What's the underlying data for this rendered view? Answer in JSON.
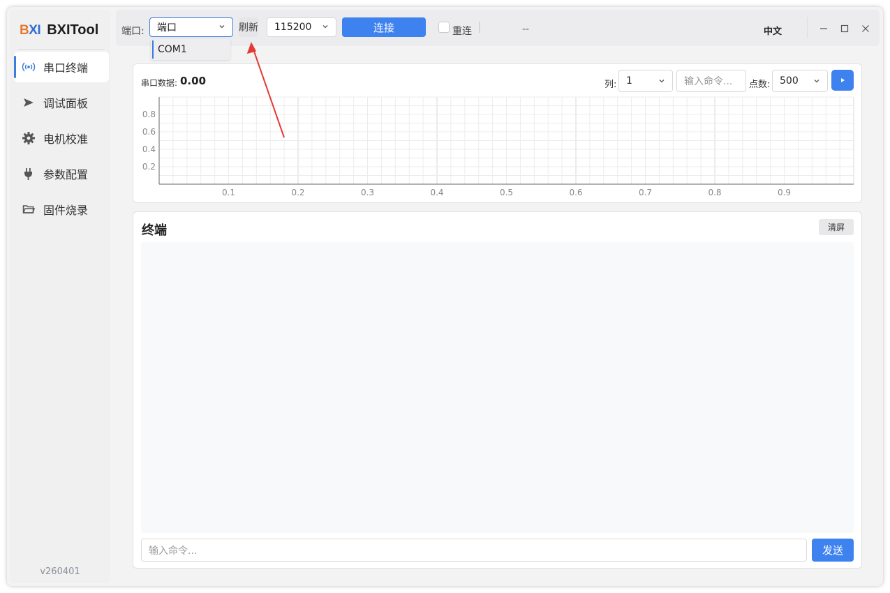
{
  "app": {
    "logo_part1": "B",
    "logo_part2": "XI",
    "name": "BXITool",
    "version": "v260401"
  },
  "sidebar": {
    "items": [
      {
        "label": "串口终端",
        "icon": "signal-icon",
        "active": true
      },
      {
        "label": "调试面板",
        "icon": "send-icon",
        "active": false
      },
      {
        "label": "电机校准",
        "icon": "gear-icon",
        "active": false
      },
      {
        "label": "参数配置",
        "icon": "plug-icon",
        "active": false
      },
      {
        "label": "固件烧录",
        "icon": "folder-icon",
        "active": false
      }
    ]
  },
  "toolbar": {
    "port_label": "端口:",
    "port_value": "端口",
    "refresh_label": "刷新",
    "baud_value": "115200",
    "connect_label": "连接",
    "reconnect_label": "重连",
    "status_text": "--",
    "language_label": "中文"
  },
  "port_dropdown": {
    "options": [
      "COM1"
    ]
  },
  "chart_panel": {
    "serial_label": "串口数据:",
    "serial_value": "0.00",
    "column_label": "列:",
    "column_value": "1",
    "command_placeholder": "输入命令...",
    "points_label": "点数:",
    "points_value": "500"
  },
  "chart_data": {
    "type": "line",
    "series": [],
    "x_ticks": [
      "0.1",
      "0.2",
      "0.3",
      "0.4",
      "0.5",
      "0.6",
      "0.7",
      "0.8",
      "0.9"
    ],
    "y_ticks": [
      "0.2",
      "0.4",
      "0.6",
      "0.8"
    ],
    "xlim": [
      0,
      1
    ],
    "ylim": [
      0,
      1
    ],
    "grid": true
  },
  "terminal": {
    "title": "终端",
    "clear_label": "清屏",
    "input_placeholder": "输入命令...",
    "send_label": "发送"
  },
  "colors": {
    "accent": "#3e82ef",
    "annotation_arrow": "#e53935"
  }
}
